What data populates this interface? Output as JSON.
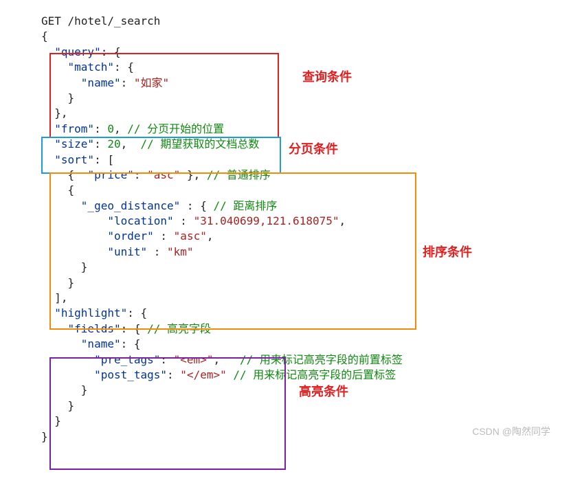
{
  "request": {
    "method": "GET",
    "path": "/hotel/_search"
  },
  "query_block": {
    "query_key": "\"query\"",
    "match_key": "\"match\"",
    "name_key": "\"name\"",
    "name_value": "\"如家\""
  },
  "paging": {
    "from_key": "\"from\"",
    "from_value": "0",
    "from_comment": "// 分页开始的位置",
    "size_key": "\"size\"",
    "size_value": "20",
    "size_comment": "// 期望获取的文档总数"
  },
  "sort": {
    "sort_key": "\"sort\"",
    "price_key": "\"price\"",
    "price_value": "\"asc\"",
    "price_comment": "// 普通排序",
    "geo_key": "\"_geo_distance\"",
    "geo_comment": "// 距离排序",
    "location_key": "\"location\"",
    "location_value": "\"31.040699,121.618075\"",
    "order_key": "\"order\"",
    "order_value": "\"asc\"",
    "unit_key": "\"unit\"",
    "unit_value": "\"km\""
  },
  "highlight": {
    "highlight_key": "\"highlight\"",
    "fields_key": "\"fields\"",
    "fields_comment": "// 高亮字段",
    "name_key": "\"name\"",
    "pre_key": "\"pre_tags\"",
    "pre_value": "\"<em>\"",
    "pre_comment": "// 用来标记高亮字段的前置标签",
    "post_key": "\"post_tags\"",
    "post_value": "\"</em>\"",
    "post_comment": "// 用来标记高亮字段的后置标签"
  },
  "labels": {
    "query": "查询条件",
    "paging": "分页条件",
    "sort": "排序条件",
    "highlight": "高亮条件"
  },
  "watermark": "CSDN @陶然同学"
}
